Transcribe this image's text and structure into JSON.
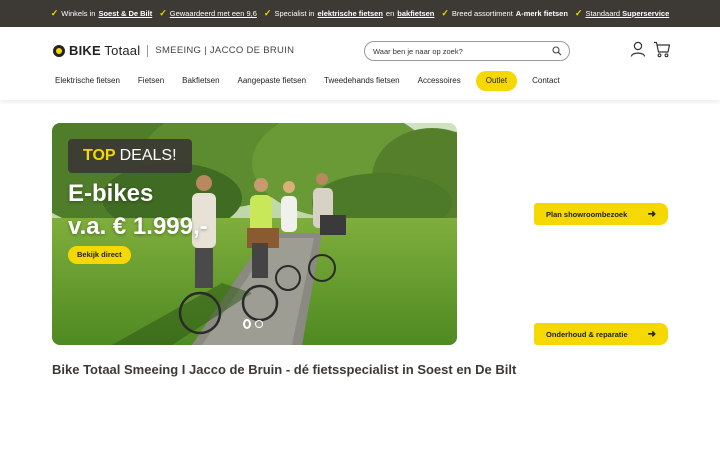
{
  "usp": {
    "items": [
      {
        "pre": "Winkels in ",
        "link": "Soest & De Bilt",
        "post": ""
      },
      {
        "pre": "",
        "link": "Gewaardeerd met een 9,6",
        "post": ""
      },
      {
        "pre": "Specialist in ",
        "link": "elektrische fietsen",
        "mid": " en ",
        "link2": "bakfietsen"
      },
      {
        "pre": "Breed assortiment ",
        "bold": "A-merk fietsen"
      },
      {
        "pre": "",
        "link": "Standaard ",
        "boldlink": "Superservice"
      }
    ]
  },
  "header": {
    "logo_bold": "BIKE",
    "logo_rest": " Totaal",
    "logo_sub": "SMEEING | JACCO DE BRUIN",
    "search_placeholder": "Waar ben je naar op zoek?"
  },
  "nav": {
    "items": [
      "Elektrische fietsen",
      "Fietsen",
      "Bakfietsen",
      "Aangepaste fietsen",
      "Tweedehands fietsen",
      "Accessoires",
      "Outlet",
      "Contact"
    ]
  },
  "hero": {
    "deal_highlight": "TOP",
    "deal_rest": "DEALS!",
    "title": "E-bikes",
    "price": "v.a. € 1.999,-",
    "cta": "Bekijk direct"
  },
  "side_buttons": {
    "showroom": "Plan showroombezoek",
    "service": "Onderhoud & reparatie"
  },
  "page": {
    "heading": "Bike Totaal Smeeing I Jacco de Bruin - dé fietsspecialist in Soest en De Bilt"
  },
  "colors": {
    "accent": "#f5d800",
    "dark": "#3d3935"
  }
}
